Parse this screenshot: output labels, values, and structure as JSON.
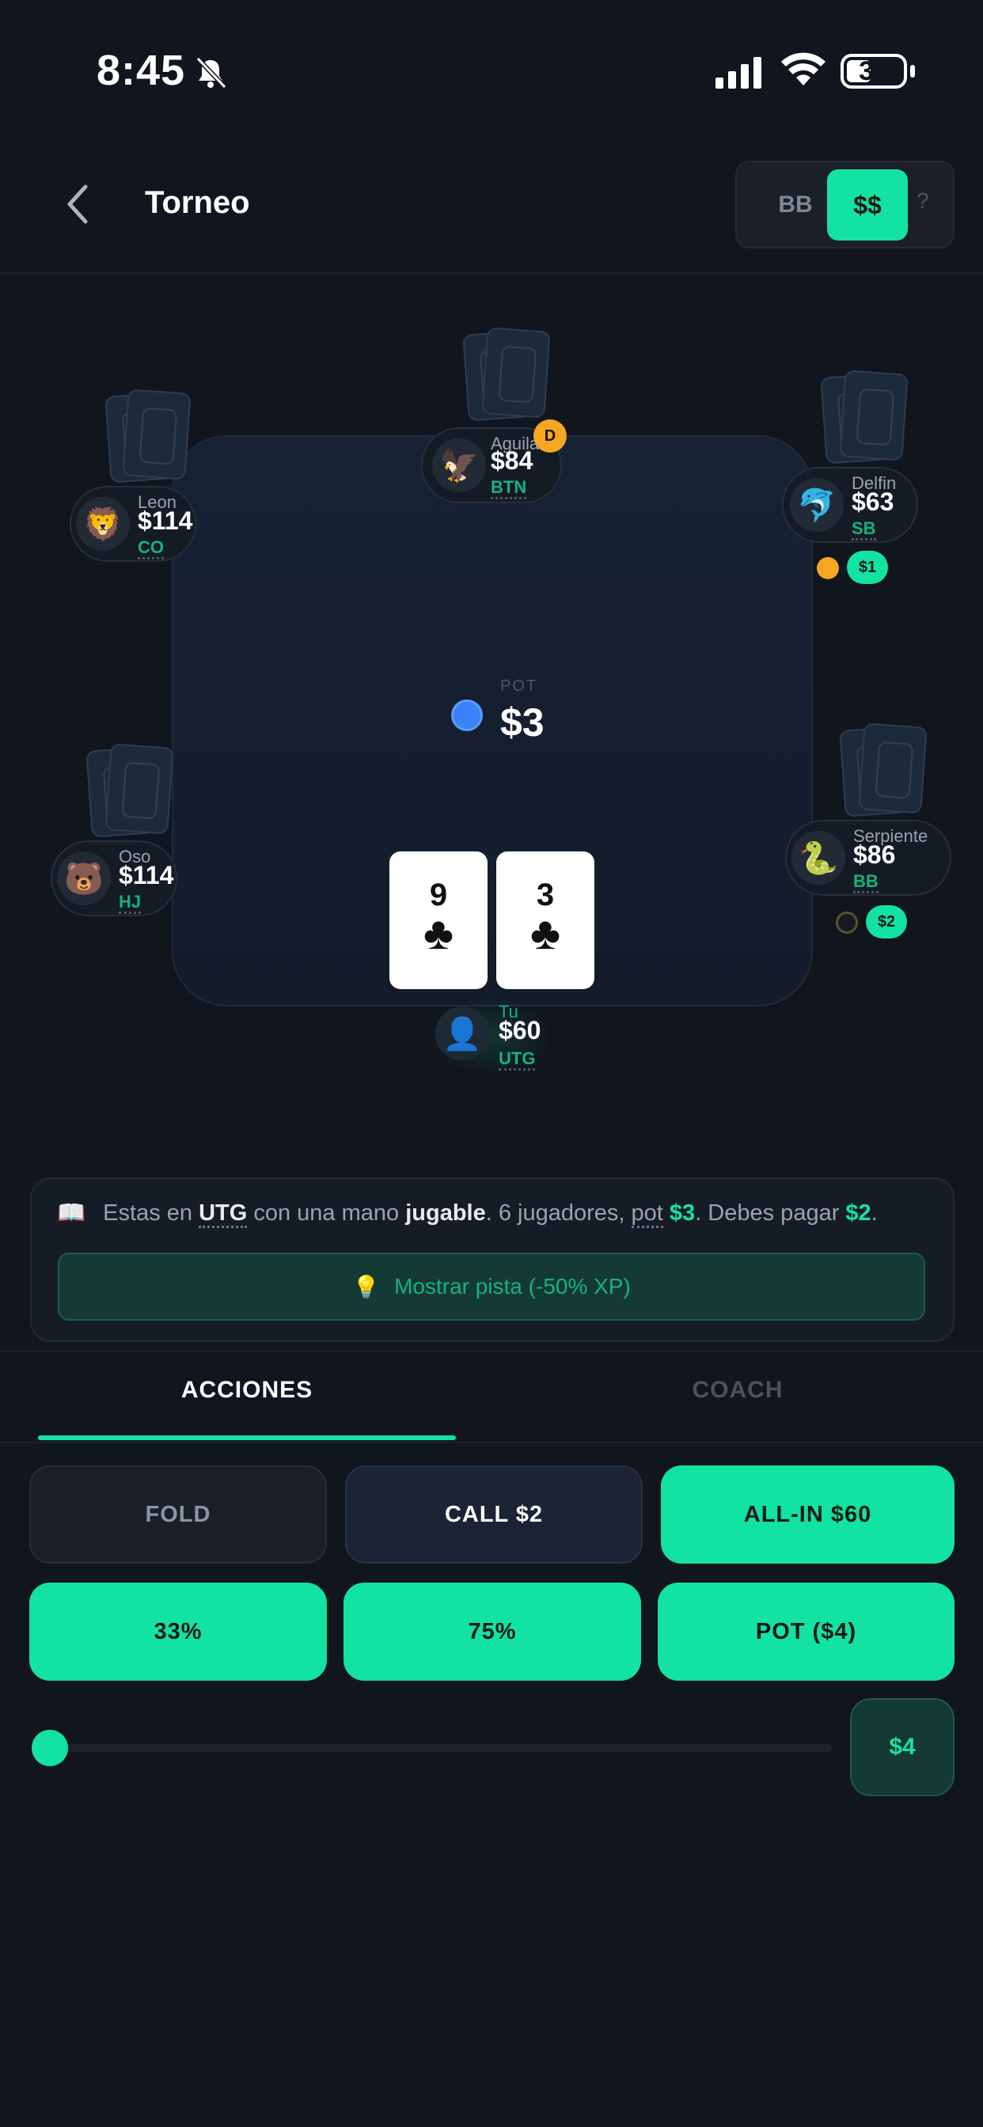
{
  "status_bar": {
    "time": "8:45",
    "battery": "35"
  },
  "header": {
    "title": "Torneo",
    "toggle": {
      "bb_label": "BB",
      "ss_label": "$$",
      "help_label": "?"
    }
  },
  "table": {
    "pot_label": "POT",
    "pot_value": "$3",
    "players": [
      {
        "id": "aguila",
        "name": "Aguila",
        "stack": "$84",
        "position": "BTN",
        "avatar": "🦅",
        "dealer_label": "D"
      },
      {
        "id": "delfin",
        "name": "Delfin",
        "stack": "$63",
        "position": "SB",
        "avatar": "🐬",
        "bet": "$1"
      },
      {
        "id": "leon",
        "name": "Leon",
        "stack": "$114",
        "position": "CO",
        "avatar": "🦁"
      },
      {
        "id": "oso",
        "name": "Oso",
        "stack": "$114",
        "position": "HJ",
        "avatar": "🐻"
      },
      {
        "id": "serpiente",
        "name": "Serpiente",
        "stack": "$86",
        "position": "BB",
        "avatar": "🐍",
        "bet": "$2"
      },
      {
        "id": "tu",
        "name": "Tu",
        "stack": "$60",
        "position": "UTG",
        "avatar": "👤"
      }
    ],
    "hero_cards": [
      {
        "rank": "9",
        "suit": "♣"
      },
      {
        "rank": "3",
        "suit": "♣"
      }
    ]
  },
  "info": {
    "book_icon": "📖",
    "t1": "Estas en ",
    "pos": "UTG",
    "t2": " con una mano ",
    "hand_quality": "jugable",
    "t3": ". 6 jugadores, ",
    "pot_word": "pot",
    "t4": " ",
    "pot_amount": "$3",
    "t5": ". Debes pagar ",
    "to_call": "$2",
    "t6": ".",
    "hint_icon": "💡",
    "hint_label": "Mostrar pista (-50% XP)"
  },
  "tabs": {
    "actions": "ACCIONES",
    "coach": "COACH"
  },
  "actions": {
    "fold": "FOLD",
    "call": "CALL $2",
    "allin": "ALL-IN $60",
    "bet33": "33%",
    "bet75": "75%",
    "pot": "POT ($4)"
  },
  "slider": {
    "value_label": "$4",
    "level": 0
  },
  "colors": {
    "accent": "#12e3a0",
    "background": "#11151d",
    "felt": "#172235",
    "pot_chip": "#3b82f6",
    "dealer": "#f5a623"
  }
}
